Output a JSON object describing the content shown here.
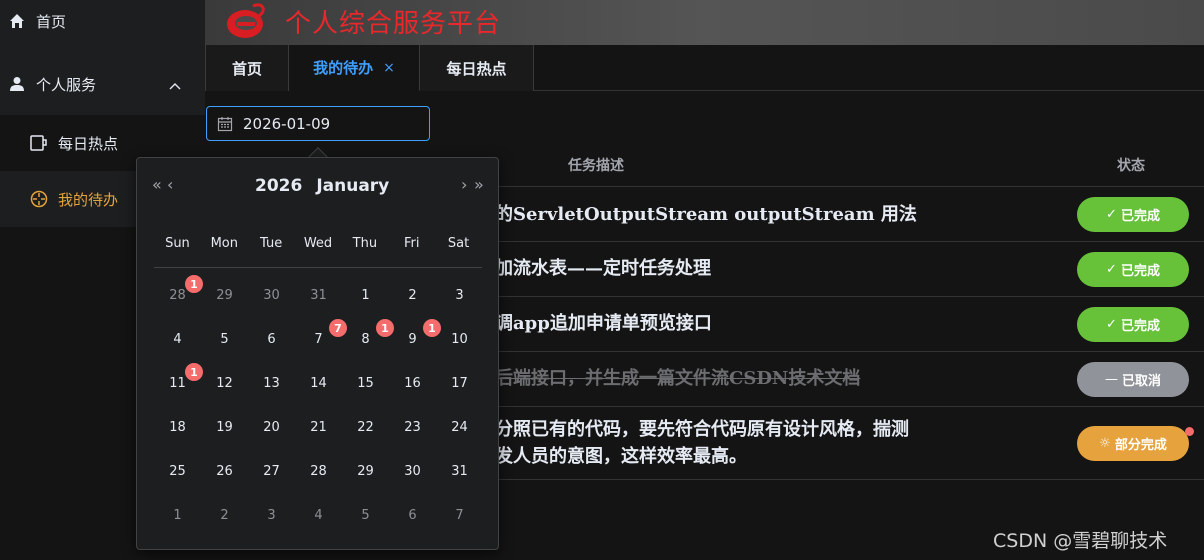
{
  "sidebar": {
    "home": "首页",
    "personal": "个人服务",
    "daily": "每日热点",
    "todo": "我的待办"
  },
  "header": {
    "title": "个人综合服务平台"
  },
  "tabs": [
    {
      "label": "首页"
    },
    {
      "label": "我的待办",
      "close": "×"
    },
    {
      "label": "每日热点"
    }
  ],
  "date_input": {
    "value": "2026-01-09"
  },
  "table": {
    "col_desc": "任务描述",
    "col_status": "状态",
    "rows": [
      {
        "desc": "的ServletOutputStream outputStream 用法",
        "status": "已完成",
        "icon": "✓"
      },
      {
        "desc": "加流水表——定时任务处理",
        "status": "已完成",
        "icon": "✓"
      },
      {
        "desc": "调app追加申请单预览接口",
        "status": "已完成",
        "icon": "✓"
      },
      {
        "desc": "后端接口，并生成一篇文件流CSDN技术文档",
        "status": "已取消",
        "icon": "—"
      },
      {
        "desc_lines": [
          "分照已有的代码，要先符合代码原有设计风格，揣测",
          "发人员的意图，这样效率最高。"
        ],
        "status": "部分完成",
        "icon": "☼"
      }
    ]
  },
  "calendar": {
    "year": "2026",
    "month": "January",
    "nav": {
      "prev_year": "«",
      "prev_month": "‹",
      "next_month": "›",
      "next_year": "»"
    },
    "weekdays": [
      "Sun",
      "Mon",
      "Tue",
      "Wed",
      "Thu",
      "Fri",
      "Sat"
    ],
    "weeks": [
      [
        "28",
        "29",
        "30",
        "31",
        "1",
        "2",
        "3"
      ],
      [
        "4",
        "5",
        "6",
        "7",
        "8",
        "9",
        "10"
      ],
      [
        "11",
        "12",
        "13",
        "14",
        "15",
        "16",
        "17"
      ],
      [
        "18",
        "19",
        "20",
        "21",
        "22",
        "23",
        "24"
      ],
      [
        "25",
        "26",
        "27",
        "28",
        "29",
        "30",
        "31"
      ],
      [
        "1",
        "2",
        "3",
        "4",
        "5",
        "6",
        "7"
      ]
    ],
    "badges": [
      {
        "week": 0,
        "day": 0,
        "count": "1"
      },
      {
        "week": 1,
        "day": 3,
        "count": "7"
      },
      {
        "week": 1,
        "day": 4,
        "count": "1"
      },
      {
        "week": 1,
        "day": 5,
        "count": "1"
      },
      {
        "week": 2,
        "day": 0,
        "count": "1"
      }
    ]
  },
  "watermark": "CSDN @雪碧聊技术",
  "colors": {
    "accent": "#409eff",
    "active_menu": "#e6a23c",
    "done": "#67c23a",
    "cancelled": "#909399",
    "partial": "#e6a23c",
    "badge": "#f56c6c",
    "brand": "#e8282b"
  }
}
